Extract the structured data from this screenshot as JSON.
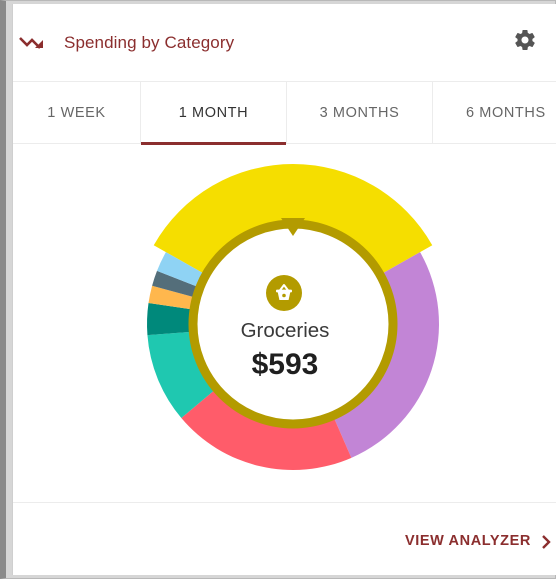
{
  "header": {
    "title": "Spending by Category",
    "trend_icon": "trending-down-icon",
    "settings_icon": "gear-icon"
  },
  "tabs": [
    {
      "label": "1 WEEK",
      "active": false
    },
    {
      "label": "1 MONTH",
      "active": true
    },
    {
      "label": "3 MONTHS",
      "active": false
    },
    {
      "label": "6 MONTHS",
      "active": false
    }
  ],
  "selected": {
    "category": "Groceries",
    "amount": "$593",
    "icon": "shopping-basket-icon"
  },
  "footer": {
    "link_label": "VIEW ANALYZER",
    "link_icon": "chevron-right-icon"
  },
  "colors": {
    "accent": "#8b2e2e",
    "selected_ring": "#b39b00"
  },
  "chart_data": {
    "type": "pie",
    "style": "donut",
    "selected_index": 0,
    "slices": [
      {
        "value": 593,
        "color": "#f5de00"
      },
      {
        "value": 470,
        "color": "#c285d6"
      },
      {
        "value": 360,
        "color": "#ff5c6a"
      },
      {
        "value": 175,
        "color": "#1fc8b0"
      },
      {
        "value": 62,
        "color": "#00897b"
      },
      {
        "value": 34,
        "color": "#ffb74d"
      },
      {
        "value": 30,
        "color": "#546e7a"
      },
      {
        "value": 40,
        "color": "#8fd3f4"
      }
    ]
  }
}
